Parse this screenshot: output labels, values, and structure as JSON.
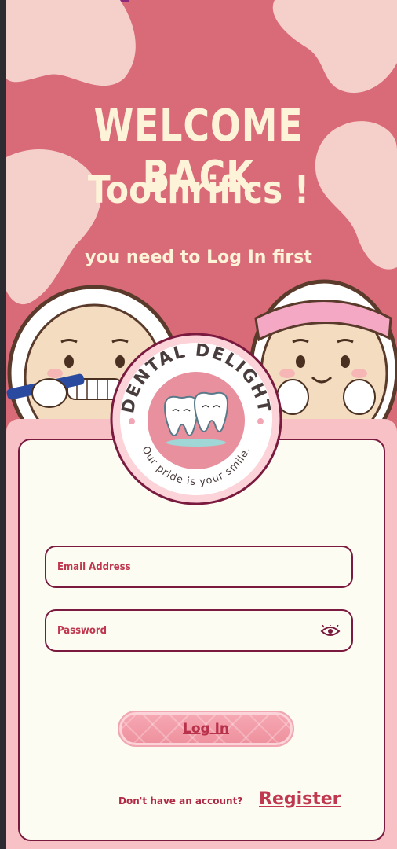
{
  "header": {
    "welcome": "WELCOME BACK",
    "brand": "Toothrifics !",
    "subtitle": "you need to Log In first"
  },
  "logo": {
    "top_text": "DENTAL DELIGHT",
    "bottom_text": "Our pride is your smile."
  },
  "form": {
    "email_placeholder": "Email Address",
    "password_placeholder": "Password",
    "login_label": "Log In",
    "signup_prompt": "Don't have an account?",
    "register_label": "Register"
  },
  "colors": {
    "background": "#d96a78",
    "blob": "#f5d0cb",
    "card": "#f7c1c5",
    "panel": "#fdfcf2",
    "accent_dark": "#7a1a3f",
    "accent_text": "#c0384f",
    "headline": "#fdf3d9"
  },
  "icons": {
    "password_toggle": "eye-icon"
  }
}
